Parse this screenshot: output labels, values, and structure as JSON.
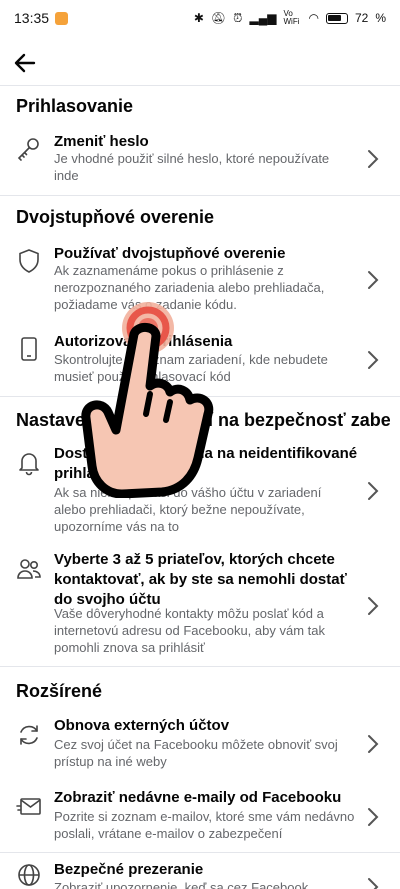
{
  "status": {
    "time": "13:35",
    "battery": "72",
    "network": "Vo WiFi"
  },
  "sections": {
    "login": "Prihlasovanie",
    "twofactor": "Dvojstupňové overenie",
    "security": "Nastavenia upozornení na bezpečnosť zabezpečenia",
    "advanced": "Rozšírené"
  },
  "rows": {
    "password": {
      "title": "Zmeniť heslo",
      "desc": "Je vhodné použiť silné heslo, ktoré nepoužívate inde"
    },
    "use2fa": {
      "title": "Používať dvojstupňové overenie",
      "desc": "Ak zaznamenáme pokus o prihlásenie z nerozpoznaného zariadenia alebo prehliadača, požiadame vás o zadanie kódu."
    },
    "authorized": {
      "title": "Autorizované prihlásenia",
      "desc": "Skontrolujte si zoznam zariadení, kde nebudete musieť použiť prihlasovací kód"
    },
    "alerts": {
      "title": "Dostávať upozornenia na neidentifikované prihlásenia",
      "desc": "Ak sa niekto prihlási do vášho účtu v zariadení alebo prehliadači, ktorý bežne nepoužívate, upozorníme vás na to"
    },
    "friends": {
      "title": "Vyberte 3 až 5 priateľov, ktorých chcete kontaktovať, ak by ste sa nemohli dostať do svojho účtu",
      "desc": "Vaše dôveryhodné kontakty môžu poslať kód a internetovú adresu od Facebooku, aby vám tak pomohli znova sa prihlásiť"
    },
    "recovery": {
      "title": "Obnova externých účtov",
      "desc": "Cez svoj účet na Facebooku môžete obnoviť svoj prístup na iné weby"
    },
    "emails": {
      "title": "Zobraziť nedávne e-maily od Facebooku",
      "desc": "Pozrite si zoznam e-mailov, ktoré sme vám nedávno poslali, vrátane e-mailov o zabezpečení"
    },
    "browsing": {
      "title": "Bezpečné prezeranie",
      "desc": "Zobraziť upozornenie, keď sa cez Facebook"
    }
  }
}
